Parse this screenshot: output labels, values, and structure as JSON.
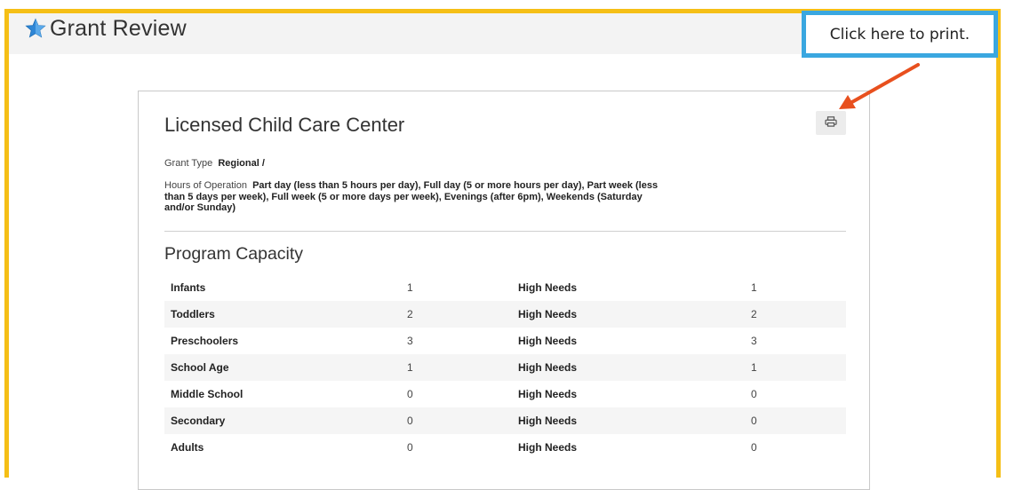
{
  "app": {
    "title": "Grant Review"
  },
  "callout": {
    "text": "Click here to print."
  },
  "card": {
    "title": "Licensed Child Care Center",
    "print_icon": "printer-icon",
    "grant_type": {
      "label": "Grant Type",
      "value": "Regional /"
    },
    "hours": {
      "label": "Hours of Operation",
      "value": "Part day (less than 5 hours per day), Full day (5 or more hours per day), Part week (less than 5 days per week), Full week (5 or more days per week), Evenings (after 6pm), Weekends (Saturday and/or Sunday)"
    },
    "section_title": "Program Capacity",
    "rows": [
      {
        "category": "Infants",
        "count": "1",
        "label": "High Needs",
        "high_needs": "1"
      },
      {
        "category": "Toddlers",
        "count": "2",
        "label": "High Needs",
        "high_needs": "2"
      },
      {
        "category": "Preschoolers",
        "count": "3",
        "label": "High Needs",
        "high_needs": "3"
      },
      {
        "category": "School Age",
        "count": "1",
        "label": "High Needs",
        "high_needs": "1"
      },
      {
        "category": "Middle School",
        "count": "0",
        "label": "High Needs",
        "high_needs": "0"
      },
      {
        "category": "Secondary",
        "count": "0",
        "label": "High Needs",
        "high_needs": "0"
      },
      {
        "category": "Adults",
        "count": "0",
        "label": "High Needs",
        "high_needs": "0"
      }
    ]
  },
  "colors": {
    "frame": "#f5bf16",
    "callout_border": "#3aa7e0",
    "arrow": "#e8501e",
    "star": "#2e86d6"
  }
}
